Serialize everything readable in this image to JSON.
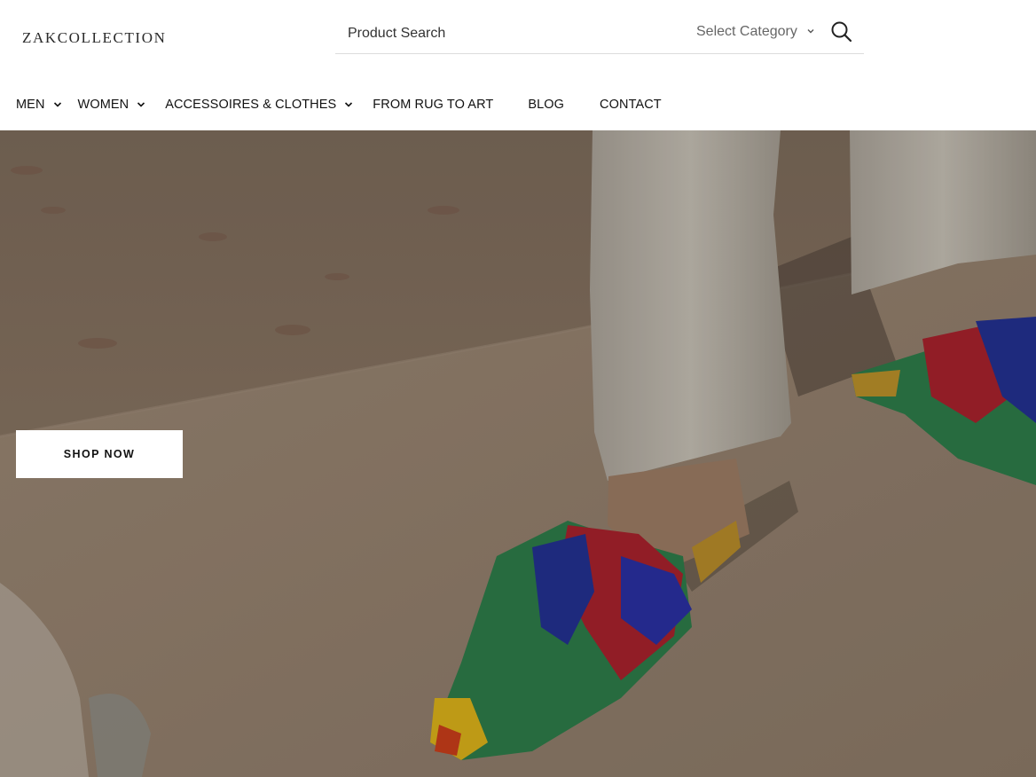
{
  "brand": {
    "logo": "ZAKCOLLECTION"
  },
  "search": {
    "placeholder": "Product Search",
    "category_label": "Select Category",
    "category_icon": "chevron-down-icon",
    "button_icon": "search-icon"
  },
  "nav": {
    "items": [
      {
        "label": "MEN",
        "has_dropdown": true
      },
      {
        "label": "WOMEN",
        "has_dropdown": true
      },
      {
        "label": "ACCESSOIRES & CLOTHES",
        "has_dropdown": true
      },
      {
        "label": "FROM RUG TO ART",
        "has_dropdown": false
      },
      {
        "label": "BLOG",
        "has_dropdown": false
      },
      {
        "label": "CONTACT",
        "has_dropdown": false
      }
    ]
  },
  "hero": {
    "cta_label": "SHOP NOW"
  },
  "colors": {
    "text": "#111111",
    "hero_overlay": "#8a7967",
    "divider": "#dcdcdc"
  }
}
